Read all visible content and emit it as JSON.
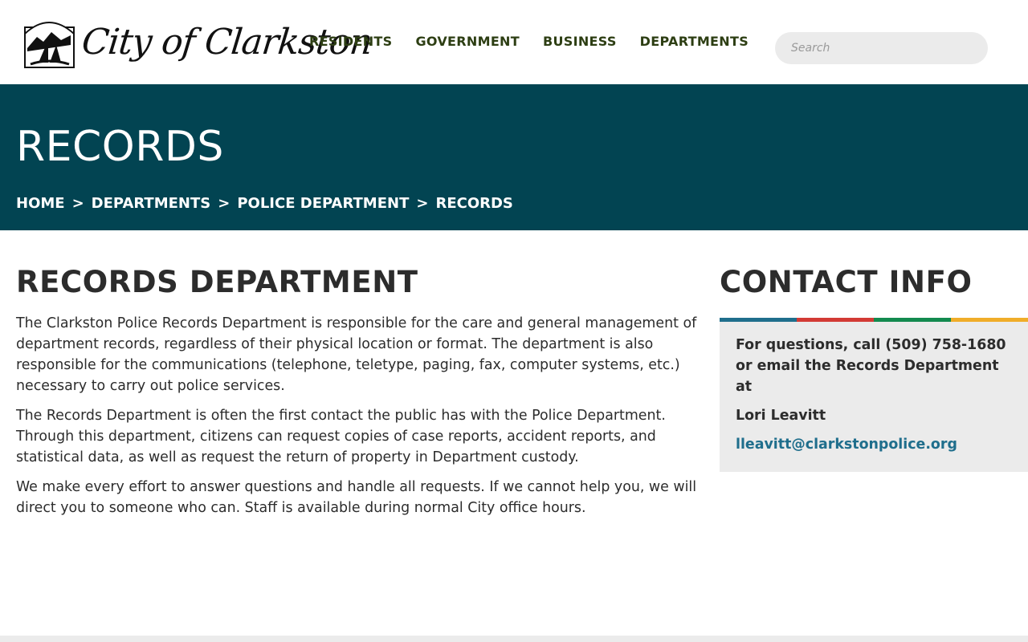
{
  "header": {
    "logo_text": "City of Clarkston",
    "nav": [
      {
        "label": "RESIDENTS"
      },
      {
        "label": "GOVERNMENT"
      },
      {
        "label": "BUSINESS"
      },
      {
        "label": "DEPARTMENTS"
      }
    ],
    "search": {
      "placeholder": "Search",
      "value": ""
    }
  },
  "hero": {
    "title": "RECORDS",
    "breadcrumb": [
      {
        "label": "HOME"
      },
      {
        "label": "DEPARTMENTS"
      },
      {
        "label": "POLICE DEPARTMENT"
      },
      {
        "label": "RECORDS"
      }
    ],
    "separator": ">",
    "background_color": "#024452"
  },
  "main": {
    "heading": "RECORDS DEPARTMENT",
    "paragraphs": [
      "The Clarkston Police Records Department is responsible for the care and general management of department records, regardless of their physical location or format. The department is also responsible for the communications (telephone, teletype, paging, fax, computer systems, etc.) necessary to carry out police services.",
      "The Records Department is often the first contact the public has with the Police Department. Through this department, citizens can request copies of case reports, accident reports, and statistical data, as well as request the return of property in Department custody.",
      "We make every effort to answer questions and handle all requests. If we cannot help you, we will direct you to someone who can. Staff is available during normal City office hours."
    ]
  },
  "sidebar": {
    "heading": "CONTACT INFO",
    "strip_colors": [
      "#1f6e8c",
      "#d33a35",
      "#138a4f",
      "#f0ad29"
    ],
    "intro": "For questions, call (509) 758-1680 or email the Records Department at",
    "contact_name": "Lori Leavitt",
    "email": "lleavitt@clarkstonpolice.org"
  }
}
